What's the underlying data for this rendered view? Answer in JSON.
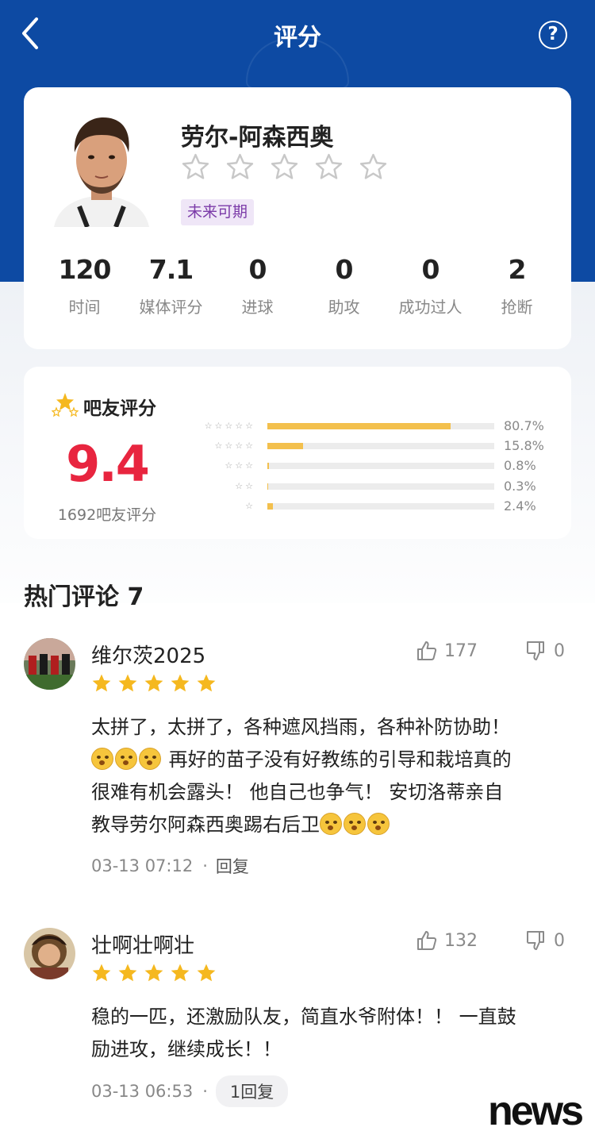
{
  "header": {
    "title": "评分"
  },
  "player": {
    "name": "劳尔-阿森西奥",
    "tag": "未来可期",
    "stats": [
      {
        "value": "120",
        "label": "时间"
      },
      {
        "value": "7.1",
        "label": "媒体评分"
      },
      {
        "value": "0",
        "label": "进球"
      },
      {
        "value": "0",
        "label": "助攻"
      },
      {
        "value": "0",
        "label": "成功过人"
      },
      {
        "value": "2",
        "label": "抢断"
      }
    ]
  },
  "fan_rating": {
    "title": "吧友评分",
    "score": "9.4",
    "count": "1692吧友评分",
    "distribution": [
      {
        "stars": 5,
        "pct_text": "80.7%",
        "fraction": 0.807
      },
      {
        "stars": 4,
        "pct_text": "15.8%",
        "fraction": 0.158
      },
      {
        "stars": 3,
        "pct_text": "0.8%",
        "fraction": 0.008
      },
      {
        "stars": 2,
        "pct_text": "0.3%",
        "fraction": 0.003
      },
      {
        "stars": 1,
        "pct_text": "2.4%",
        "fraction": 0.024
      }
    ],
    "bar_color": "#f3c04d"
  },
  "comments_section": {
    "title": "热门评论 7",
    "comments": [
      {
        "user": "维尔茨2025",
        "rating": 5,
        "likes": "177",
        "dislikes": "0",
        "text_line1": "太拼了，太拼了，各种遮风挡雨，各种补防协助！",
        "text_line2": "再好的苗子没有好教练的引导和栽培真的",
        "text_line3": "很难有机会露头！ 他自己也争气！ 安切洛蒂亲自",
        "text_line4": "教导劳尔阿森西奥踢右后卫",
        "time": "03-13 07:12",
        "reply": "回复"
      },
      {
        "user": "壮啊壮啊壮",
        "rating": 5,
        "likes": "132",
        "dislikes": "0",
        "text_line1": "稳的一匹，还激励队友，简直水爷附体！！ 一直鼓",
        "text_line2": "励进攻，继续成长！！",
        "time": "03-13 06:53",
        "reply": "1回复"
      }
    ]
  },
  "watermark": "news",
  "colors": {
    "header_blue": "#0d4aa3",
    "score_red": "#e8253f",
    "star_gold": "#f5b81f",
    "tag_purple": "#7b3aa8"
  }
}
